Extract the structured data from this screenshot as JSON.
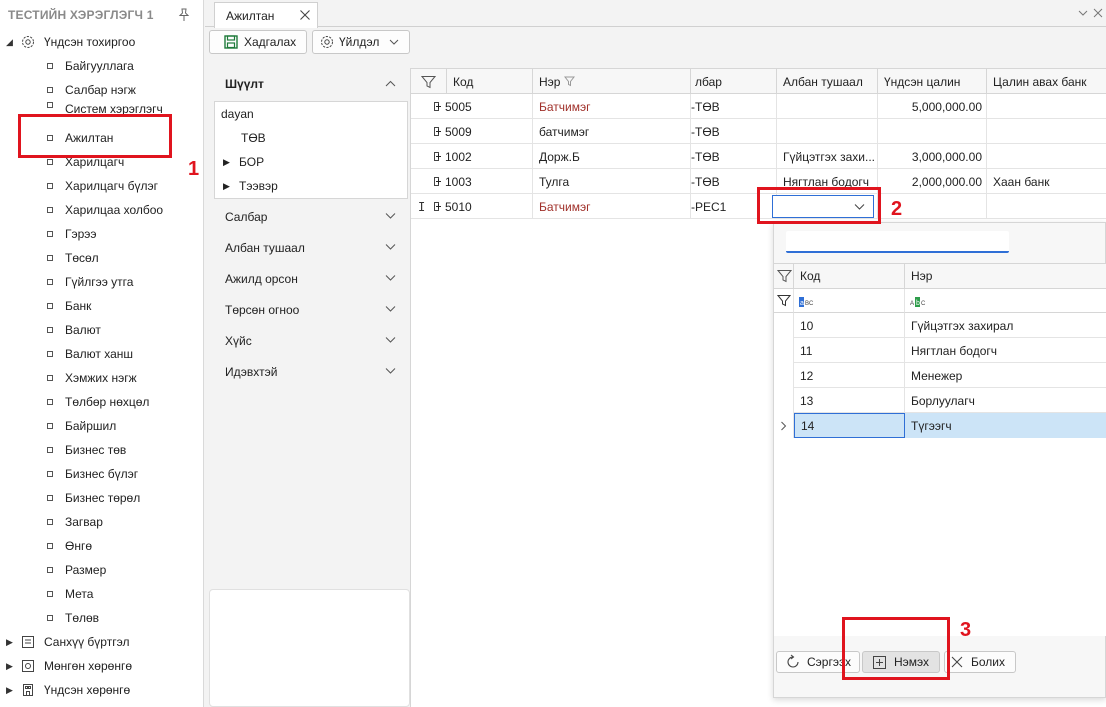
{
  "sidebar": {
    "header": "ТЕСТИЙН ХЭРЭГЛЭГЧ 1",
    "root_settings": "Үндсэн тохиргоо",
    "items": [
      "Байгууллага",
      "Салбар нэгж",
      "Систем хэрэглэгч",
      "Ажилтан",
      "Харилцагч",
      "Харилцагч бүлэг",
      "Харилцаа холбоо",
      "Гэрээ",
      "Төсөл",
      "Гүйлгээ утга",
      "Банк",
      "Валют",
      "Валют ханш",
      "Хэмжих нэгж",
      "Төлбөр нөхцөл",
      "Байршил",
      "Бизнес төв",
      "Бизнес бүлэг",
      "Бизнес төрөл",
      "Загвар",
      "Өнгө",
      "Размер",
      "Мета",
      "Төлөв"
    ],
    "roots_bottom": [
      "Санхүү бүртгэл",
      "Мөнгөн хөрөнгө",
      "Үндсэн хөрөнгө"
    ]
  },
  "tabs": {
    "active": "Ажилтан"
  },
  "toolbar": {
    "save_label": "Хадгалах",
    "action_label": "Үйлдэл"
  },
  "filter": {
    "title": "Шүүлт",
    "tree": {
      "root": "dayan",
      "children": [
        "ТӨВ",
        "БОР",
        "Тээвэр"
      ]
    },
    "sections": [
      "Салбар",
      "Албан тушаал",
      "Ажилд орсон",
      "Төрсөн огноо",
      "Хүйс",
      "Идэвхтэй"
    ]
  },
  "grid": {
    "columns": [
      "Код",
      "Нэр",
      "лбар",
      "Албан тушаал",
      "Үндсэн цалин",
      "Цалин авах банк"
    ],
    "rows": [
      {
        "code": "5005",
        "name": "Батчимэг",
        "branch": "-ТӨВ",
        "position": "",
        "salary": "5,000,000.00",
        "bank": ""
      },
      {
        "code": "5009",
        "name": "батчимэг",
        "branch": "-ТӨВ",
        "position": "",
        "salary": "",
        "bank": ""
      },
      {
        "code": "1002",
        "name": "Дорж.Б",
        "branch": "-ТӨВ",
        "position": "Гүйцэтгэх захи...",
        "salary": "3,000,000.00",
        "bank": ""
      },
      {
        "code": "1003",
        "name": "Тулга",
        "branch": "-ТӨВ",
        "position": "Нягтлан бодогч",
        "salary": "2,000,000.00",
        "bank": "Хаан банк"
      },
      {
        "code": "5010",
        "name": "Батчимэг",
        "branch": "-РЕС1",
        "position": "",
        "salary": "",
        "bank": ""
      }
    ]
  },
  "dropdown": {
    "columns": [
      "Код",
      "Нэр"
    ],
    "filter_icons": [
      "abc-filter-icon",
      "abc-filter-icon"
    ],
    "rows": [
      {
        "code": "10",
        "name": "Гүйцэтгэх захирал"
      },
      {
        "code": "11",
        "name": "Нягтлан бодогч"
      },
      {
        "code": "12",
        "name": "Менежер"
      },
      {
        "code": "13",
        "name": "Борлуулагч"
      },
      {
        "code": "14",
        "name": "Түгээгч"
      }
    ],
    "selected_index": 4,
    "buttons": {
      "refresh": "Сэргээх",
      "add": "Нэмэх",
      "cancel": "Болих"
    }
  },
  "annotations": [
    "1",
    "2",
    "3"
  ],
  "colors": {
    "accent": "#2f6fd6",
    "annotation": "#e0141e",
    "link_red": "#a0302a",
    "selection": "#cce4f7"
  }
}
